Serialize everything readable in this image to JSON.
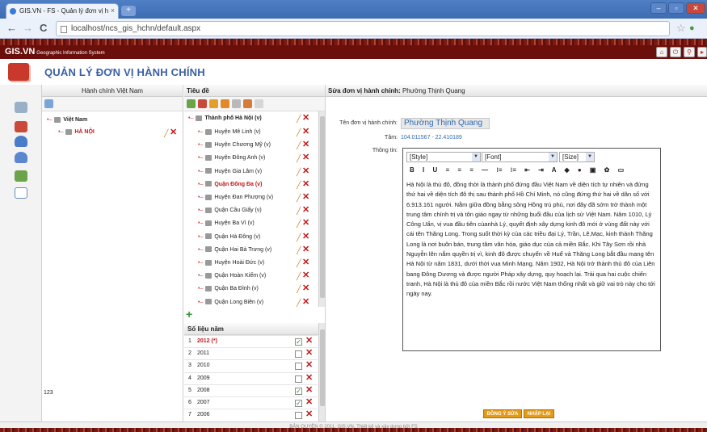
{
  "browser": {
    "tab_title": "GIS.VN - FS - Quản lý đơn vị h",
    "new_tab": "+",
    "url": "localhost/ncs_gis_hchn/default.aspx",
    "close_tab": "×"
  },
  "app": {
    "logo": "GIS.VN",
    "logo_sub": "Geographic Information System",
    "page_title": "QUẢN LÝ ĐƠN VỊ HÀNH CHÍNH"
  },
  "left_panel": {
    "header": "Hành chính Việt Nam",
    "root": "Việt Nam",
    "child": "HÀ NỘI",
    "bottom_value": "123"
  },
  "middle_panel": {
    "header": "Tiêu đề",
    "city": "Thành phố Hà Nội (v)",
    "districts": [
      "Huyện Mê Linh (v)",
      "Huyện Chương Mỹ (v)",
      "Huyện Đông Anh (v)",
      "Huyện Gia Lâm (v)",
      "Quận Đống Đa (v)",
      "Huyện Đan Phượng (v)",
      "Quận Cầu Giấy (v)",
      "Huyện Ba Vì (v)",
      "Quận Hà Đông (v)",
      "Quận Hai Bà Trưng (v)",
      "Huyện Hoài Đức (v)",
      "Quận Hoàn Kiếm (v)",
      "Quận Ba Đình (v)",
      "Quận Long Biên (v)"
    ],
    "add_label": "+",
    "years_header": "Số liệu năm",
    "years": [
      {
        "idx": "1",
        "year": "2012 (*)",
        "checked": true
      },
      {
        "idx": "2",
        "year": "2011",
        "checked": false
      },
      {
        "idx": "3",
        "year": "2010",
        "checked": false
      },
      {
        "idx": "4",
        "year": "2009",
        "checked": false
      },
      {
        "idx": "5",
        "year": "2008",
        "checked": true
      },
      {
        "idx": "6",
        "year": "2007",
        "checked": true
      },
      {
        "idx": "7",
        "year": "2006",
        "checked": false
      }
    ]
  },
  "edit_panel": {
    "header_label": "Sửa đơn vị hành chính:",
    "header_value": "Phường Thịnh Quang",
    "name_label": "Tên đơn vị hành chính:",
    "name_value": "Phường Thịnh Quang",
    "center_label": "Tâm:",
    "center_value": "104.011567 - 22.410189",
    "info_label": "Thông tin:",
    "style_select": "[Style]",
    "font_select": "[Font]",
    "size_select": "[Size]",
    "format_buttons": "B I U ≡ ≡ ≡ — ⁝≡ ⁝≡ ⇤ ⇥ A ◆ ● ▣ ✿ ▭",
    "content": "Hà Nội là thủ đô, đồng thời là thành phố đứng đầu Việt Nam về diện tích tự nhiên và đứng thứ hai về diện tích đô thị sau thành phố Hồ Chí Minh, nó cũng đứng thứ hai về dân số với 6.913.161 người. Nằm giữa đồng bằng sông Hồng trù phú, nơi đây đã sớm trở thành một trung tâm chính trị và tôn giáo ngay từ những buổi đầu của lịch sử Việt Nam. Năm 1010, Lý Công Uẩn, vị vua đầu tiên củanhà Lý, quyết định xây dựng kinh đô mới ở vùng đất này với cái tên Thăng Long. Trong suốt thời kỳ của các triều đại Lý, Trần, Lê,Mạc, kinh thành Thăng Long là nơi buôn bán, trung tâm văn hóa, giáo dục của cả miền Bắc. Khi Tây Sơn rồi nhà Nguyễn lên nắm quyền trị vì, kinh đô được chuyển về Huế và Thăng Long bắt đầu mang tên Hà Nội từ năm 1831, dưới thời vua Minh Mạng. Năm 1902, Hà Nội trở thành thủ đô của Liên bang Đông Dương và được người Pháp xây dựng, quy hoạch lại. Trải qua hai cuộc chiến tranh, Hà Nội là thủ đô của miền Bắc rồi nước Việt Nam thống nhất và giữ vai trò này cho tới ngày nay.",
    "save_button": "ĐỒNG Ý SỬA",
    "reset_button": "NHẬP LẠI"
  },
  "footer": "BẢN QUYỀN © 2011, GIS.VN. Thiết kế và xây dựng bởi FS",
  "colors": {
    "brand": "#6b0f0c",
    "title": "#3a5fa8",
    "delete": "#c0161a",
    "button": "#e39b1a"
  }
}
